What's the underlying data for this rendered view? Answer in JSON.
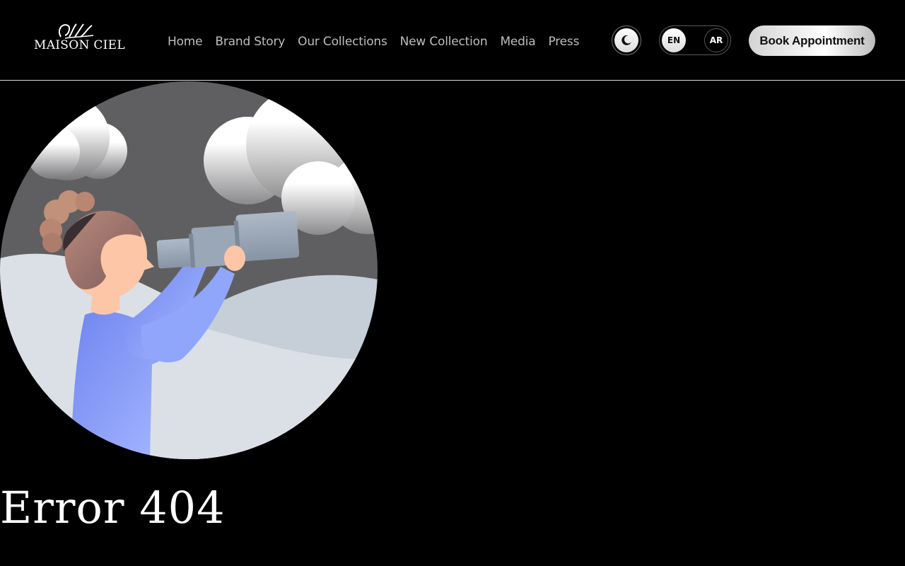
{
  "brand": {
    "name": "MAISON CIEL",
    "logo_icon": "calligraphy-mark"
  },
  "nav": {
    "items": [
      {
        "label": "Home"
      },
      {
        "label": "Brand Story"
      },
      {
        "label": "Our Collections"
      },
      {
        "label": "New Collection"
      },
      {
        "label": "Media"
      },
      {
        "label": "Press"
      }
    ]
  },
  "theme_toggle": {
    "icon": "moon-icon"
  },
  "language": {
    "en": "EN",
    "ar": "AR",
    "selected": "EN"
  },
  "cta": {
    "label": "Book Appointment"
  },
  "error": {
    "title": "Error 404"
  },
  "colors": {
    "background": "#000000",
    "nav_text": "#bdbdbd",
    "sky": "#5f5f61",
    "hills": "#dbe0e7",
    "sweater": "#8aa0f7"
  }
}
